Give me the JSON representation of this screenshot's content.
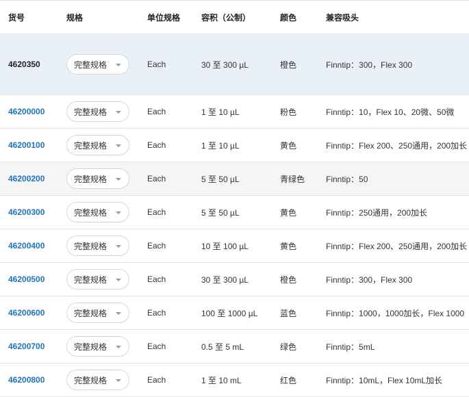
{
  "table": {
    "headers": [
      "货号",
      "规格",
      "单位规格",
      "容积（公制）",
      "颜色",
      "兼容吸头"
    ],
    "rows": [
      {
        "sku": "4620350",
        "spec": "完整规格",
        "unit": "Each",
        "volume": "30 至 300 µL",
        "color": "橙色",
        "tips": "Finntip：300，Flex 300",
        "selected": true
      },
      {
        "sku": "46200000",
        "spec": "完整规格",
        "unit": "Each",
        "volume": "1 至 10 µL",
        "color": "粉色",
        "tips": "Finntip：10，Flex 10、20微、50微"
      },
      {
        "sku": "46200100",
        "spec": "完整规格",
        "unit": "Each",
        "volume": "1 至 10 µL",
        "color": "黄色",
        "tips": "Finntip：Flex 200、250通用，200加长"
      },
      {
        "sku": "46200200",
        "spec": "完整规格",
        "unit": "Each",
        "volume": "5 至 50 µL",
        "color": "青绿色",
        "tips": "Finntip：50",
        "shaded": true
      },
      {
        "sku": "46200300",
        "spec": "完整规格",
        "unit": "Each",
        "volume": "5 至 50 µL",
        "color": "黄色",
        "tips": "Finntip：250通用，200加长"
      },
      {
        "sku": "46200400",
        "spec": "完整规格",
        "unit": "Each",
        "volume": "10 至 100 µL",
        "color": "黄色",
        "tips": "Finntip：Flex 200、250通用，200加长"
      },
      {
        "sku": "46200500",
        "spec": "完整规格",
        "unit": "Each",
        "volume": "30 至 300 µL",
        "color": "橙色",
        "tips": "Finntip：300，Flex 300"
      },
      {
        "sku": "46200600",
        "spec": "完整规格",
        "unit": "Each",
        "volume": "100 至 1000 µL",
        "color": "蓝色",
        "tips": "Finntip：1000，1000加长，Flex 1000"
      },
      {
        "sku": "46200700",
        "spec": "完整规格",
        "unit": "Each",
        "volume": "0.5 至 5 mL",
        "color": "绿色",
        "tips": "Finntip：5mL"
      },
      {
        "sku": "46200800",
        "spec": "完整规格",
        "unit": "Each",
        "volume": "1 至 10 mL",
        "color": "红色",
        "tips": "Finntip：10mL，Flex 10mL加长"
      }
    ]
  },
  "colors": {
    "link": "#1a73c8",
    "selected_row_bg": "#eaf0f8",
    "shaded_row_bg": "#f5f5f5",
    "border": "#e3e3e3"
  },
  "icons": {
    "dropdown": "chevron-down-icon"
  }
}
